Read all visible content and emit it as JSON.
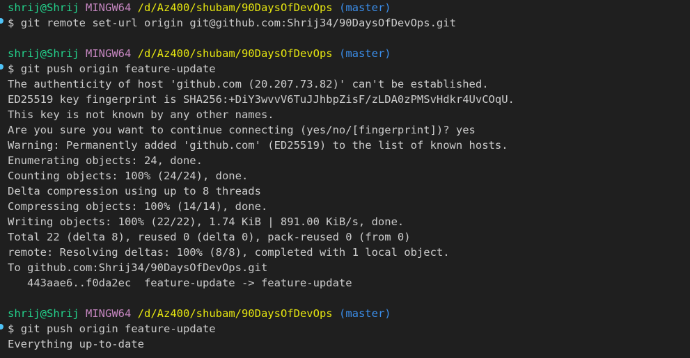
{
  "prompt": {
    "user_host": "shrij@Shrij",
    "env": "MINGW64",
    "path": "/d/Az400/shubam/90DaysOfDevOps",
    "branch": "(master)",
    "symbol": "$"
  },
  "colors": {
    "background": "#1f1f1f",
    "text": "#cccccc",
    "user": "#23d18b",
    "env": "#c586c0",
    "path": "#e5e510",
    "branch": "#3b8eea",
    "marker": "#4fc3f7"
  },
  "blocks": [
    {
      "command": "git remote set-url origin git@github.com:Shrij34/90DaysOfDevOps.git",
      "output": []
    },
    {
      "command": "git push origin feature-update",
      "output": [
        "The authenticity of host 'github.com (20.207.73.82)' can't be established.",
        "ED25519 key fingerprint is SHA256:+DiY3wvvV6TuJJhbpZisF/zLDA0zPMSvHdkr4UvCOqU.",
        "This key is not known by any other names.",
        "Are you sure you want to continue connecting (yes/no/[fingerprint])? yes",
        "Warning: Permanently added 'github.com' (ED25519) to the list of known hosts.",
        "Enumerating objects: 24, done.",
        "Counting objects: 100% (24/24), done.",
        "Delta compression using up to 8 threads",
        "Compressing objects: 100% (14/14), done.",
        "Writing objects: 100% (22/22), 1.74 KiB | 891.00 KiB/s, done.",
        "Total 22 (delta 8), reused 0 (delta 0), pack-reused 0 (from 0)",
        "remote: Resolving deltas: 100% (8/8), completed with 1 local object.",
        "To github.com:Shrij34/90DaysOfDevOps.git",
        "   443aae6..f0da2ec  feature-update -> feature-update"
      ]
    },
    {
      "command": "git push origin feature-update",
      "output": [
        "Everything up-to-date"
      ]
    }
  ]
}
